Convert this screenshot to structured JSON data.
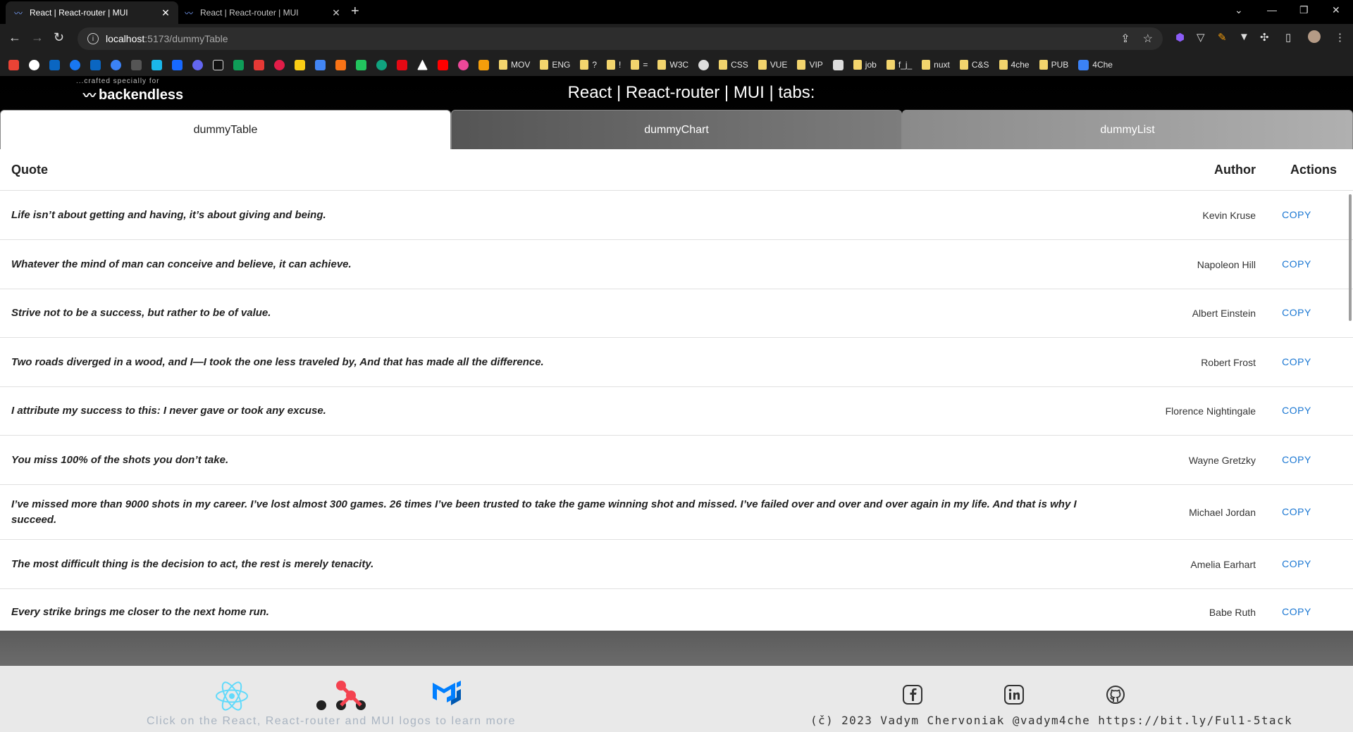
{
  "browser": {
    "tabs": [
      {
        "title": "React | React-router | MUI",
        "active": true
      },
      {
        "title": "React | React-router | MUI",
        "active": false
      }
    ],
    "url_host": "localhost",
    "url_path": ":5173/dummyTable",
    "bookmarks": [
      "MOV",
      "ENG",
      "?",
      "!",
      "=",
      "W3C",
      "CSS",
      "VUE",
      "VIP",
      "job",
      "f_j_",
      "nuxt",
      "C&S",
      "4che",
      "PUB",
      "4Che"
    ]
  },
  "app": {
    "brand_tagline": "...crafted specially for",
    "brand_name": "backendless",
    "title": "React | React-router | MUI | tabs:",
    "tabs": [
      "dummyTable",
      "dummyChart",
      "dummyList"
    ],
    "table": {
      "headers": {
        "quote": "Quote",
        "author": "Author",
        "actions": "Actions"
      },
      "copy_label": "COPY",
      "rows": [
        {
          "quote": "Life isn’t about getting and having, it’s about giving and being.",
          "author": "Kevin Kruse"
        },
        {
          "quote": "Whatever the mind of man can conceive and believe, it can achieve.",
          "author": "Napoleon Hill"
        },
        {
          "quote": "Strive not to be a success, but rather to be of value.",
          "author": "Albert Einstein"
        },
        {
          "quote": "Two roads diverged in a wood, and I—I took the one less traveled by, And that has made all the difference.",
          "author": "Robert Frost"
        },
        {
          "quote": "I attribute my success to this: I never gave or took any excuse.",
          "author": "Florence Nightingale"
        },
        {
          "quote": "You miss 100% of the shots you don’t take.",
          "author": "Wayne Gretzky"
        },
        {
          "quote": "I’ve missed more than 9000 shots in my career. I’ve lost almost 300 games. 26 times I’ve been trusted to take the game winning shot and missed. I’ve failed over and over and over again in my life. And that is why I succeed.",
          "author": "Michael Jordan"
        },
        {
          "quote": "The most difficult thing is the decision to act, the rest is merely tenacity.",
          "author": "Amelia Earhart"
        },
        {
          "quote": "Every strike brings me closer to the next home run.",
          "author": "Babe Ruth"
        }
      ]
    },
    "footer": {
      "logos_hint": "Click on the React, React-router and MUI logos to learn more",
      "copyright": "(č) 2023 Vadym Chervoniak @vadym4che https://bit.ly/Ful1-5tack"
    }
  },
  "colors": {
    "accent": "#1976d2",
    "logo_react": "#61dafb",
    "logo_router": "#f44250",
    "logo_mui": "#007fff"
  }
}
